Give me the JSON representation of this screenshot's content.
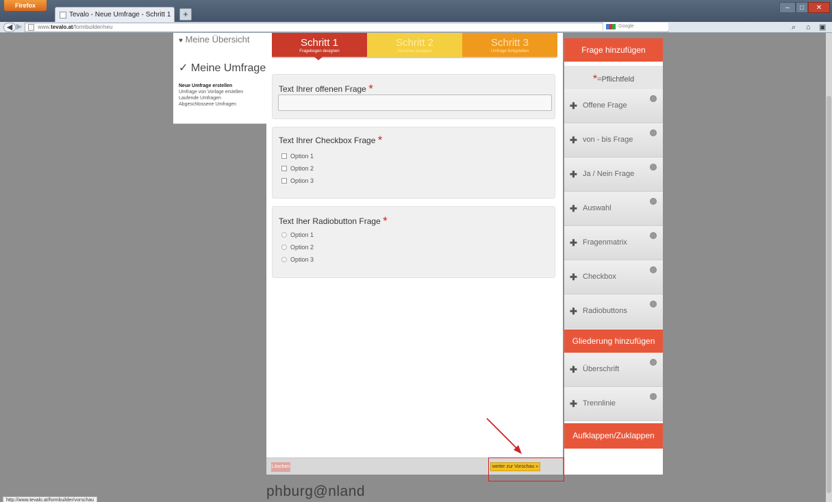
{
  "browser": {
    "menu_button": "Firefox",
    "tab_title": "Tevalo - Neue Umfrage - Schritt 1",
    "new_tab": "+",
    "url_prefix": "www.",
    "url_host": "tevalo.at",
    "url_path": "/formbuilder/neu",
    "search_placeholder": "Google",
    "status_url": "http://www.tevalo.at/formbuilder/vorschau"
  },
  "left_nav": {
    "overview": "Meine Übersicht",
    "my_surveys": "✓ Meine Umfragen",
    "links": [
      {
        "label": "Neue Umfrage erstellen",
        "active": true
      },
      {
        "label": "Umfrage von Vorlage erstellen",
        "active": false
      },
      {
        "label": "Laufende Umfragen",
        "active": false
      },
      {
        "label": "Abgeschlossene Umfragen",
        "active": false
      }
    ]
  },
  "steps": [
    {
      "title": "Schritt 1",
      "subtitle": "Fragebogen designen"
    },
    {
      "title": "Schritt 2",
      "subtitle": "Vorschau anzeigen"
    },
    {
      "title": "Schritt 3",
      "subtitle": "Umfrage fertigstellen"
    }
  ],
  "questions": {
    "open": {
      "title": "Text Ihrer offenen Frage",
      "required_mark": "*"
    },
    "checkbox": {
      "title": "Text Ihrer Checkbox Frage",
      "required_mark": "*",
      "options": [
        "Option 1",
        "Option 2",
        "Option 3"
      ]
    },
    "radio": {
      "title": "Text Iher Radiobutton Frage",
      "required_mark": "*",
      "options": [
        "Option 1",
        "Option 2",
        "Option 3"
      ]
    }
  },
  "footer": {
    "left_button": "Löschen",
    "next_button": "weiter zur Vorschau »"
  },
  "sidebar": {
    "add_question": "Frage hinzufügen",
    "legend_star": "*",
    "legend_text": "=Pflichtfeld",
    "question_types": [
      "Offene Frage",
      "von - bis Frage",
      "Ja / Nein Frage",
      "Auswahl",
      "Fragenmatrix",
      "Checkbox",
      "Radiobuttons"
    ],
    "add_structure": "Gliederung hinzufügen",
    "structure_types": [
      "Überschrift",
      "Trennlinie"
    ],
    "toggle": "Aufklappen/Zuklappen"
  },
  "logo": "phburg@nland",
  "colors": {
    "step1": "#c93a2a",
    "step2": "#f4cf3f",
    "step3": "#f09a1d",
    "sidebar_header": "#e8563a",
    "required_star": "#c8262d",
    "annotation": "#d0232a"
  }
}
